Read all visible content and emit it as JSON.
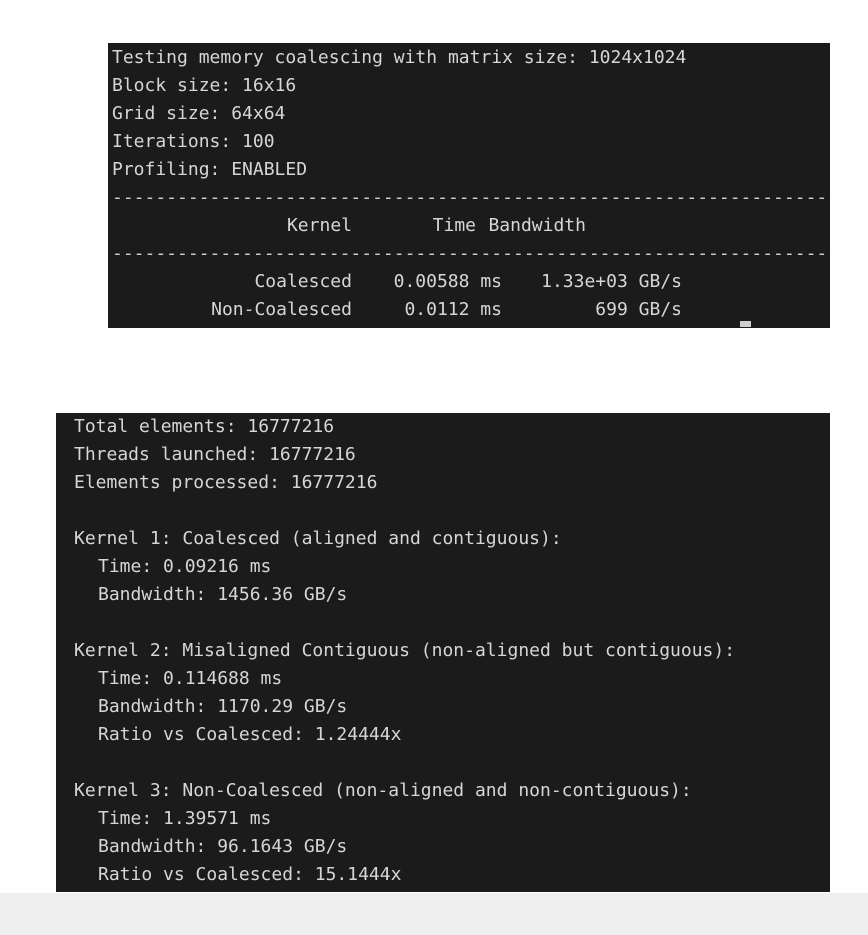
{
  "terminal1": {
    "lines": [
      "Testing memory coalescing with matrix size: 1024x1024",
      "Block size: 16x16",
      "Grid size: 64x64",
      "Iterations: 100",
      "Profiling: ENABLED"
    ],
    "separator": "--------------------------------------------------------------------------------",
    "table": {
      "headers": [
        "Kernel",
        "Time",
        "Bandwidth"
      ],
      "rows": [
        [
          "Coalesced",
          "0.00588 ms",
          "1.33e+03 GB/s"
        ],
        [
          "Non-Coalesced",
          "0.0112 ms",
          "699 GB/s"
        ]
      ]
    }
  },
  "terminal2": {
    "summary": [
      "Total elements: 16777216",
      "Threads launched: 16777216",
      "Elements processed: 16777216"
    ],
    "kernels": [
      {
        "title": "Kernel 1: Coalesced (aligned and contiguous):",
        "time": "Time: 0.09216 ms",
        "bandwidth": "Bandwidth: 1456.36 GB/s"
      },
      {
        "title": "Kernel 2: Misaligned Contiguous (non-aligned but contiguous):",
        "time": "Time: 0.114688 ms",
        "bandwidth": "Bandwidth: 1170.29 GB/s",
        "ratio": "Ratio vs Coalesced: 1.24444x"
      },
      {
        "title": "Kernel 3: Non-Coalesced (non-aligned and non-contiguous):",
        "time": "Time: 1.39571 ms",
        "bandwidth": "Bandwidth: 96.1643 GB/s",
        "ratio": "Ratio vs Coalesced: 15.1444x"
      }
    ]
  },
  "colors": {
    "terminal_background": "#1b1b1b",
    "terminal_text": "#d6d6d6",
    "page_background": "#ffffff"
  }
}
